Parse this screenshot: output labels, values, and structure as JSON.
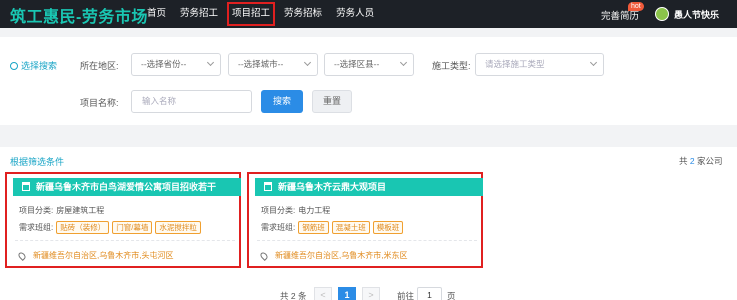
{
  "header": {
    "brand": "筑工惠民-劳务市场",
    "nav": [
      "首页",
      "劳务招工",
      "项目招工",
      "劳务招标",
      "劳务人员"
    ],
    "active_nav": "项目招工",
    "resume_label": "完善简历",
    "hot_badge": "hot",
    "user_name": "愚人节快乐"
  },
  "filter": {
    "section_title": "选择搜索",
    "region_label": "所在地区:",
    "province_placeholder": "--选择省份--",
    "city_placeholder": "--选择城市--",
    "district_placeholder": "--选择区县--",
    "type_label": "施工类型:",
    "type_placeholder": "请选择施工类型",
    "name_label": "项目名称:",
    "name_placeholder": "输入名称",
    "search_button": "搜索",
    "reset_button": "重置"
  },
  "results": {
    "section_title": "根据筛选条件",
    "count_prefix": "共",
    "count": "2",
    "count_suffix": "家公司",
    "category_label": "项目分类:",
    "teams_label": "需求班组:",
    "cards": [
      {
        "title": "新疆乌鲁木齐市白鸟湖爱情公寓项目招收若干",
        "category": "房屋建筑工程",
        "tags": [
          "贴砖（装修）",
          "门窗/幕墙",
          "水泥搅拌粒"
        ],
        "location": "新疆维吾尔自治区,乌鲁木齐市,头屯河区"
      },
      {
        "title": "新疆乌鲁木齐云鼎大观项目",
        "category": "电力工程",
        "tags": [
          "钢筋班",
          "混凝土班",
          "模板班"
        ],
        "location": "新疆维吾尔自治区,乌鲁木齐市,米东区"
      }
    ]
  },
  "pagination": {
    "total_label": "共 2 条",
    "prev": "<",
    "current_page": "1",
    "next": ">",
    "goto_label": "前往",
    "goto_value": "1",
    "page_suffix": "页"
  },
  "colors": {
    "nav_bg": "#1d2127",
    "brand": "#19c6b2",
    "card_header": "#19c6b2",
    "primary_button": "#2b8ce6",
    "highlight_border": "#e02020",
    "tag": "#e08a1c"
  }
}
